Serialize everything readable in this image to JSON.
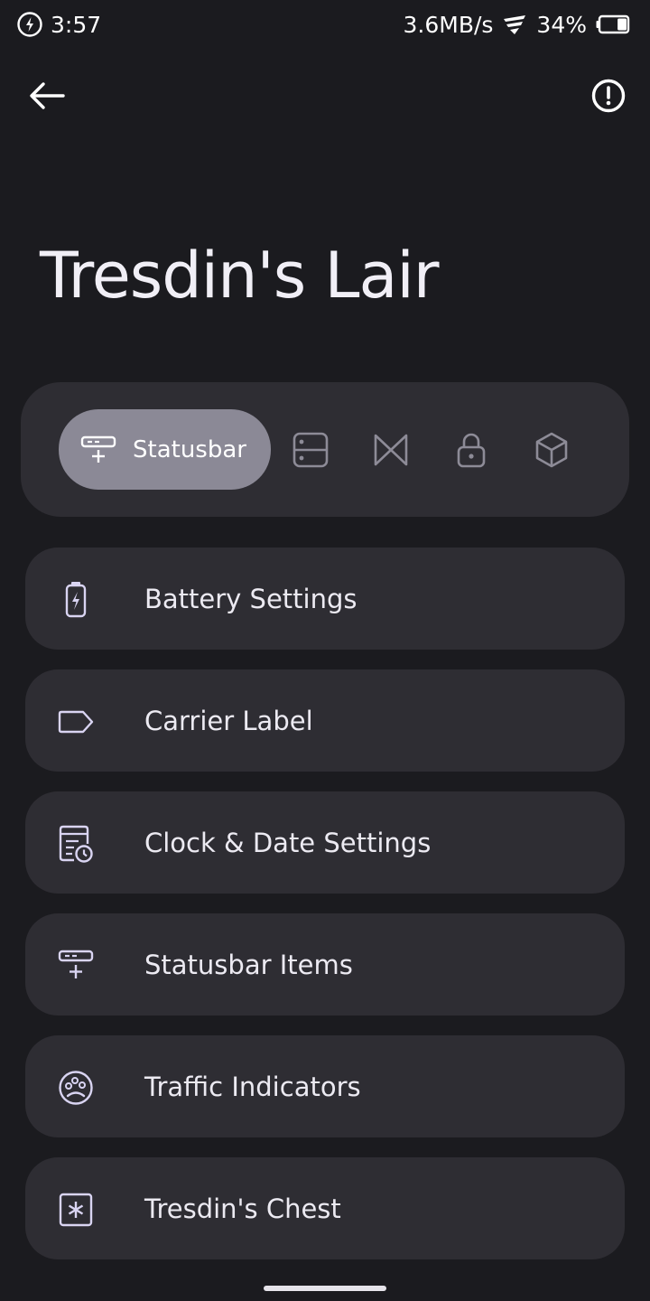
{
  "status_bar": {
    "time": "3:57",
    "net_speed": "3.6MB/s",
    "battery_percent": "34%",
    "battery_level": 0.34
  },
  "app_bar": {
    "title": "Tresdin's Lair"
  },
  "tabs": {
    "active_label": "Statusbar",
    "items": [
      {
        "id": "statusbar",
        "icon": "statusbar-icon",
        "label": "Statusbar",
        "selected": true
      },
      {
        "id": "quick-settings",
        "icon": "panel-icon",
        "selected": false
      },
      {
        "id": "media",
        "icon": "bowtie-icon",
        "selected": false
      },
      {
        "id": "lockscreen",
        "icon": "lock-icon",
        "selected": false
      },
      {
        "id": "misc",
        "icon": "cube-icon",
        "selected": false
      }
    ]
  },
  "menu": {
    "items": [
      {
        "label": "Battery Settings",
        "icon": "battery-icon"
      },
      {
        "label": "Carrier Label",
        "icon": "label-icon"
      },
      {
        "label": "Clock & Date Settings",
        "icon": "clock-date-icon"
      },
      {
        "label": "Statusbar Items",
        "icon": "statusbar-items-icon"
      },
      {
        "label": "Traffic Indicators",
        "icon": "traffic-icon"
      },
      {
        "label": "Tresdin's Chest",
        "icon": "chest-icon"
      }
    ]
  },
  "colors": {
    "background": "#1b1b1f",
    "surface": "#2e2d33",
    "active_tab": "#8b8996",
    "icon_tint": "#d9d4f2"
  }
}
